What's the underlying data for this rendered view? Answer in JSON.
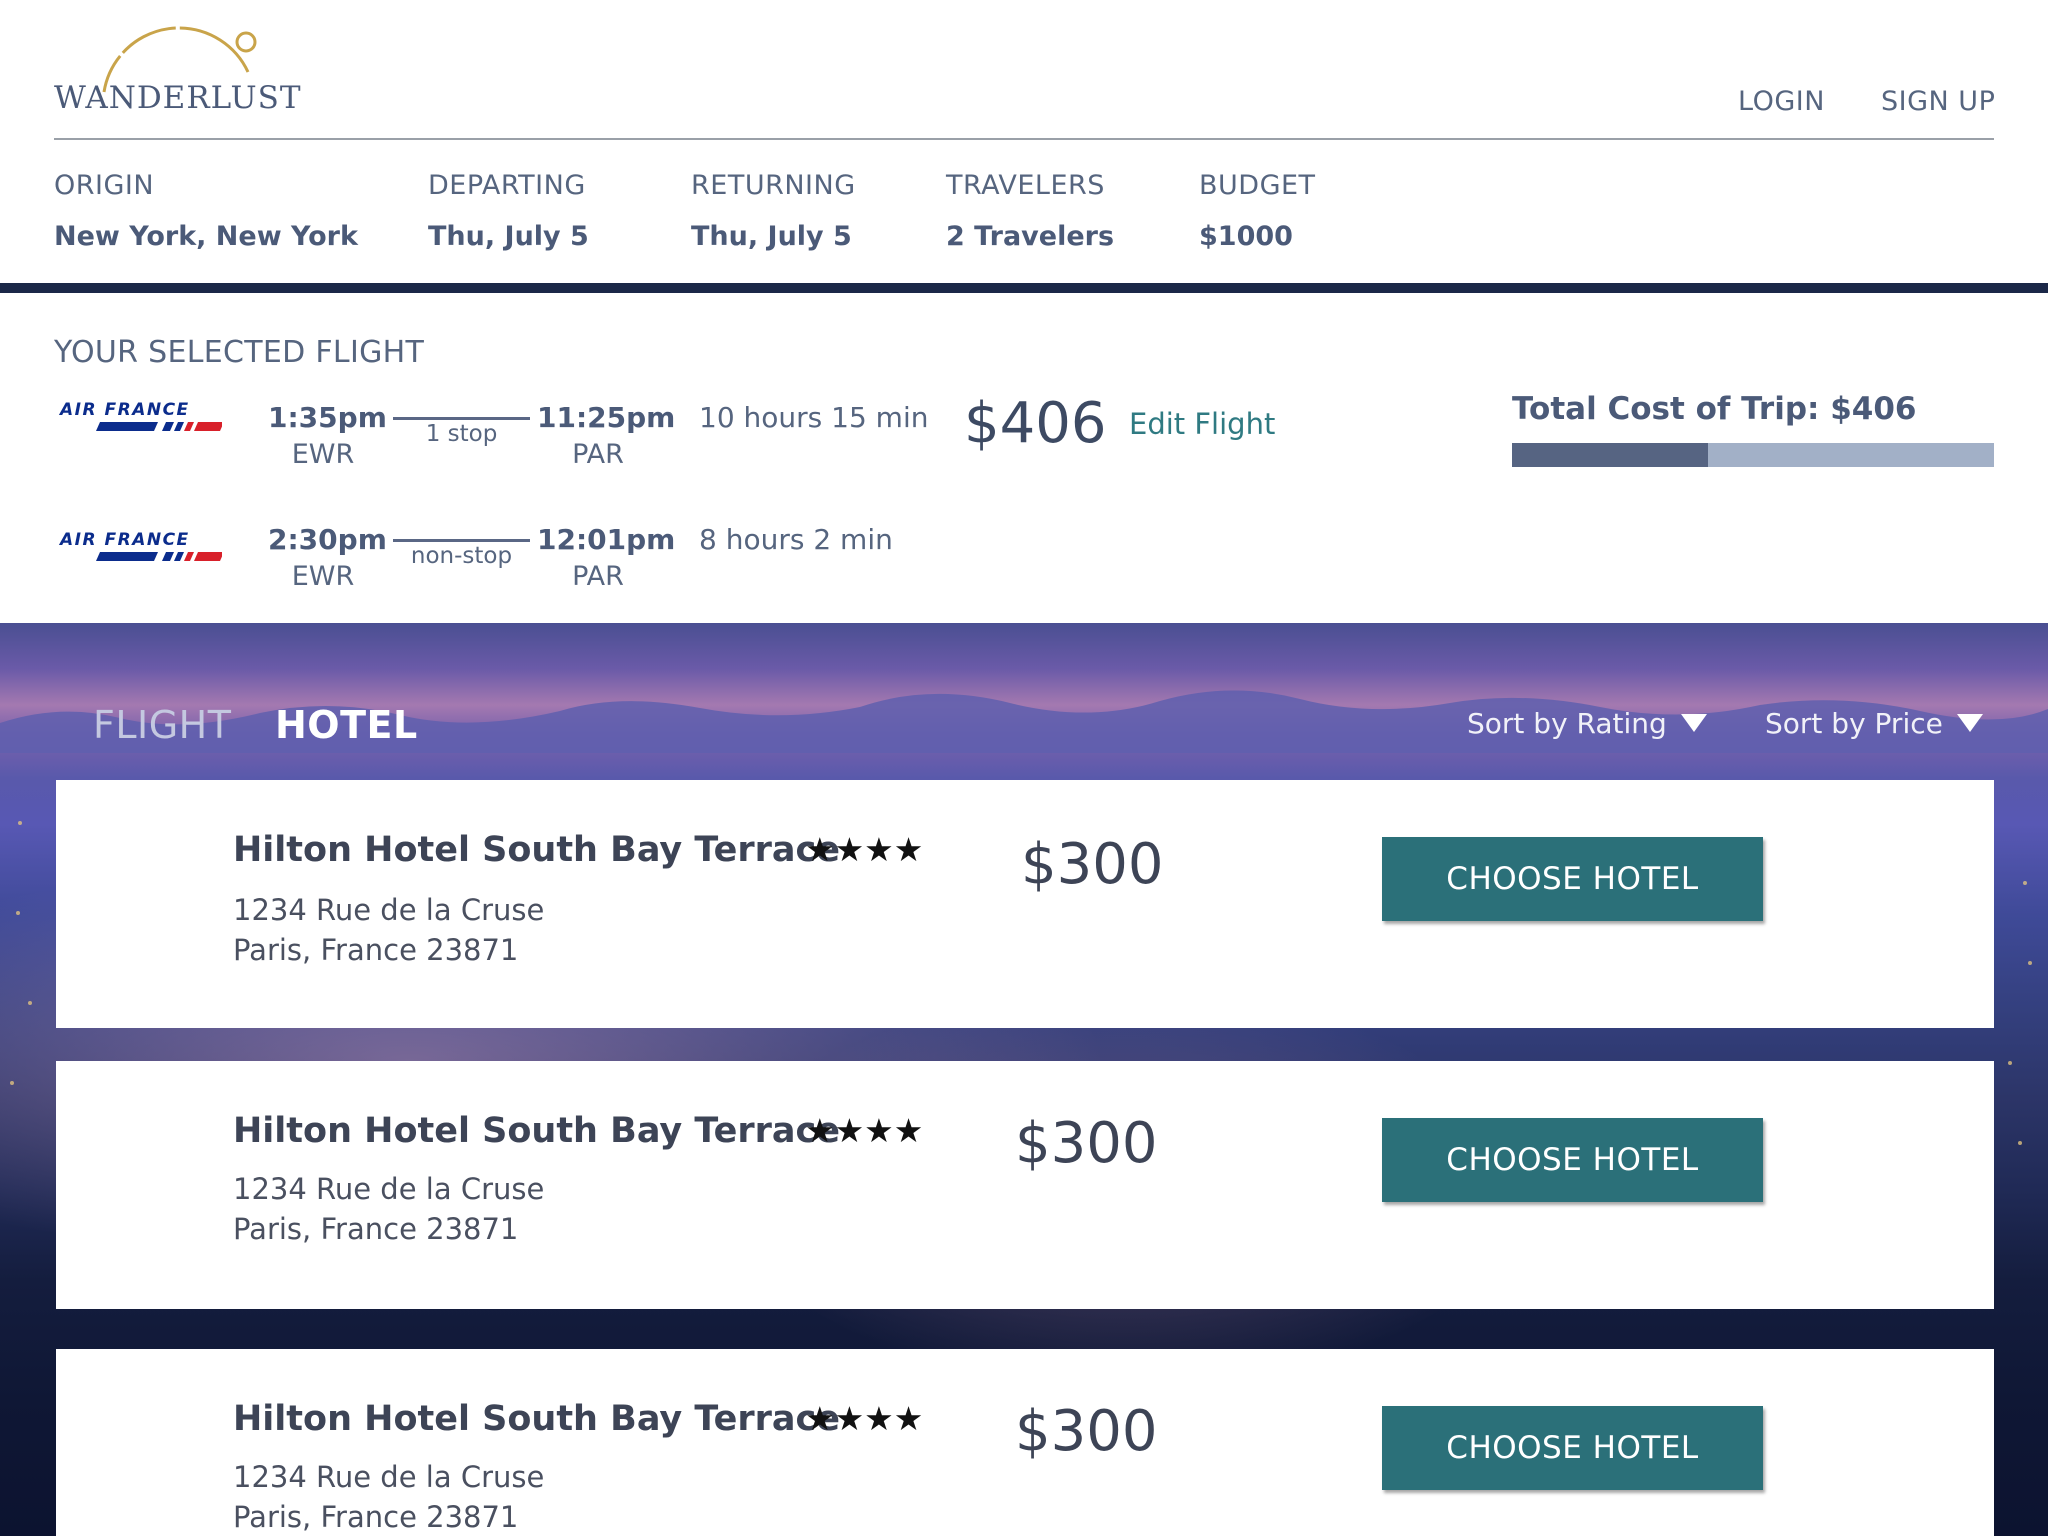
{
  "brand": {
    "name": "WANDERLUST"
  },
  "auth": {
    "login": "LOGIN",
    "signup": "SIGN UP"
  },
  "search": {
    "origin": {
      "label": "ORIGIN",
      "value": "New York, New York"
    },
    "departing": {
      "label": "DEPARTING",
      "value": "Thu, July 5"
    },
    "returning": {
      "label": "RETURNING",
      "value": "Thu, July 5"
    },
    "travelers": {
      "label": "TRAVELERS",
      "value": "2 Travelers"
    },
    "budget": {
      "label": "BUDGET",
      "value": "$1000"
    }
  },
  "selected_flight": {
    "title": "YOUR SELECTED FLIGHT",
    "airline_logo_text": "AIR FRANCE",
    "legs": [
      {
        "depart_time": "1:35pm",
        "depart_code": "EWR",
        "stops": "1 stop",
        "arrive_time": "11:25pm",
        "arrive_code": "PAR",
        "duration": "10 hours 15 min"
      },
      {
        "depart_time": "2:30pm",
        "depart_code": "EWR",
        "stops": "non-stop",
        "arrive_time": "12:01pm",
        "arrive_code": "PAR",
        "duration": "8 hours 2 min"
      }
    ],
    "price": "$406",
    "edit_label": "Edit Flight"
  },
  "trip_cost": {
    "label": "Total Cost of Trip: $406",
    "budget_fraction": 0.406
  },
  "results": {
    "tabs": [
      {
        "label": "FLIGHT",
        "active": false
      },
      {
        "label": "HOTEL",
        "active": true
      }
    ],
    "sort_rating": "Sort by Rating",
    "sort_price": "Sort by Price",
    "hotels": [
      {
        "name": "Hilton Hotel South Bay Terrace",
        "stars": "★★★★",
        "rating": 4,
        "address_line1": "1234 Rue de la Cruse",
        "address_line2": "Paris, France 23871",
        "price": "$300",
        "button": "CHOOSE HOTEL"
      },
      {
        "name": "Hilton Hotel South Bay Terrace",
        "stars": "★★★★",
        "rating": 4,
        "address_line1": "1234 Rue de la Cruse",
        "address_line2": "Paris, France 23871",
        "price": "$300",
        "button": "CHOOSE HOTEL"
      },
      {
        "name": "Hilton Hotel South Bay Terrace",
        "stars": "★★★★",
        "rating": 4,
        "address_line1": "1234 Rue de la Cruse",
        "address_line2": "Paris, France 23871",
        "price": "$300",
        "button": "CHOOSE HOTEL"
      }
    ]
  },
  "colors": {
    "navy": "#1b2848",
    "teal_button": "#2b7079",
    "edit_link": "#2f7a82",
    "text_slate": "#4b5a78",
    "logo_gold": "#c9a44a",
    "budget_fill": "#566482",
    "budget_track": "#a2b0c7"
  },
  "icons": {
    "logo_arc": "sun-arc-icon",
    "sort_arrow": "triangle-down-icon",
    "rating": "star-icon"
  }
}
